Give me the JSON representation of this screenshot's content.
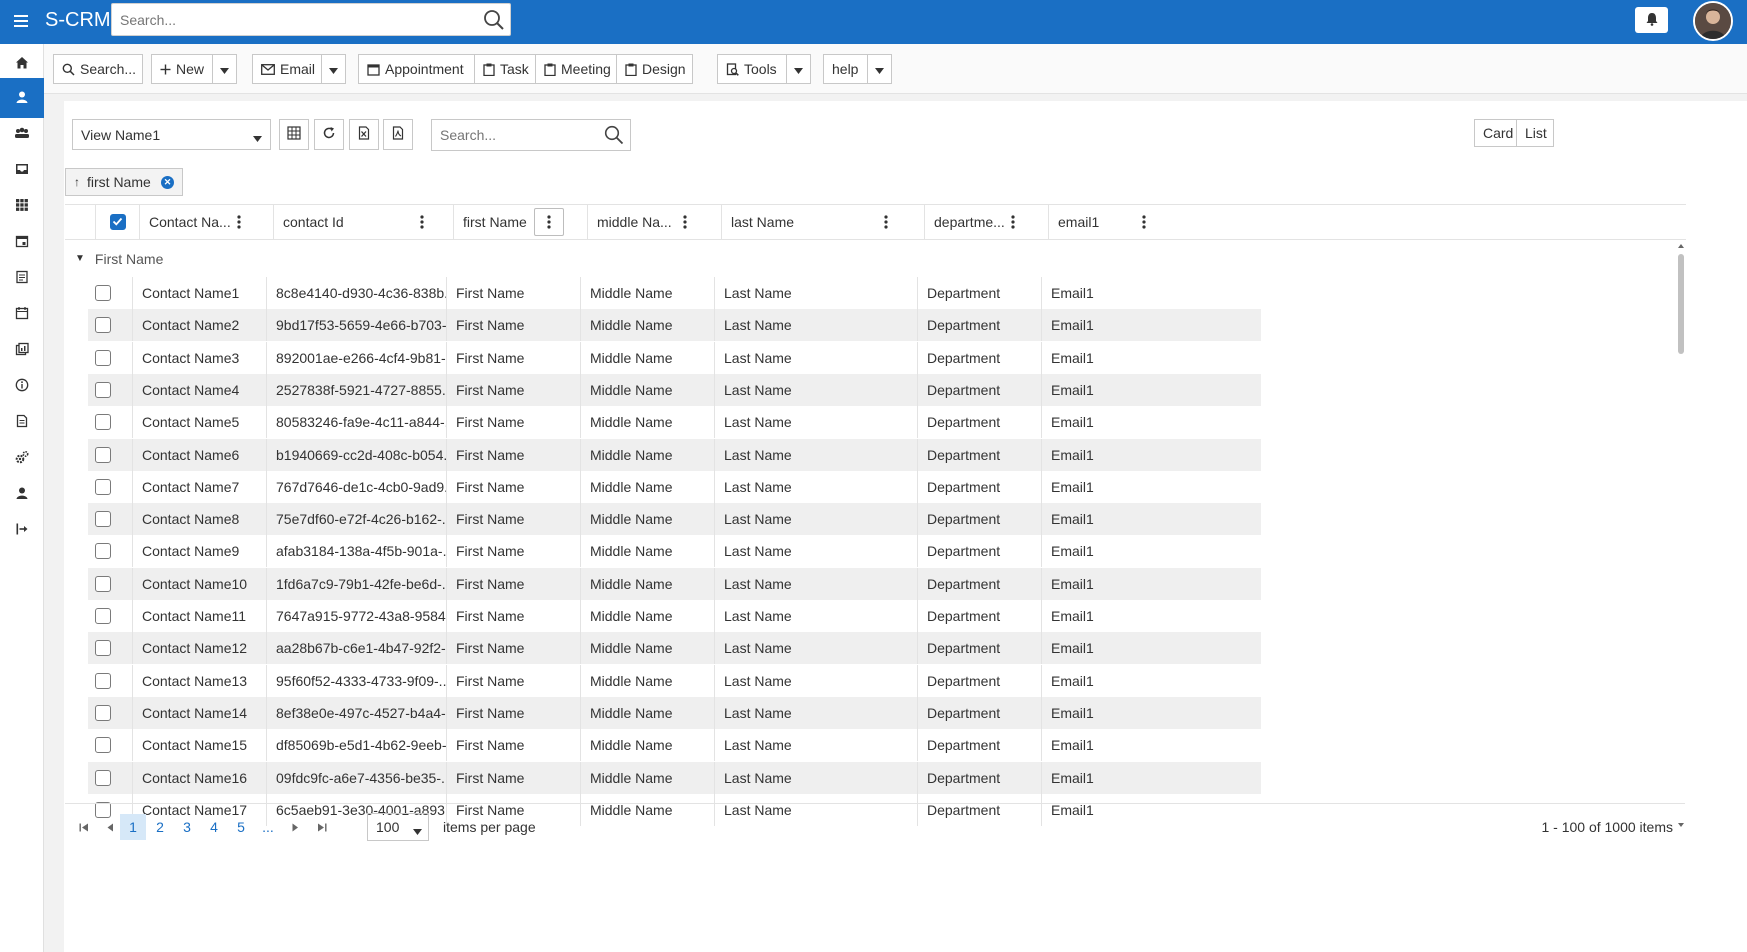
{
  "app": {
    "brand": "S-CRM",
    "search_placeholder": "Search..."
  },
  "toolbar": {
    "search_label": "Search...",
    "new_label": "New",
    "email_label": "Email",
    "appointment_label": "Appointment",
    "task_label": "Task",
    "meeting_label": "Meeting",
    "design_label": "Design",
    "tools_label": "Tools",
    "help_label": "help"
  },
  "grid_toolbar": {
    "view_name": "View Name1",
    "search_placeholder": "Search...",
    "card_label": "Card",
    "list_label": "List"
  },
  "grouping": {
    "chip_label": "first Name",
    "group_value": "First Name"
  },
  "columns": [
    "Contact Na...",
    "contact Id",
    "first Name",
    "middle Na...",
    "last Name",
    "departme...",
    "email1"
  ],
  "rows": [
    [
      "Contact Name1",
      "8c8e4140-d930-4c36-838b...",
      "First Name",
      "Middle Name",
      "Last Name",
      "Department",
      "Email1"
    ],
    [
      "Contact Name2",
      "9bd17f53-5659-4e66-b703-...",
      "First Name",
      "Middle Name",
      "Last Name",
      "Department",
      "Email1"
    ],
    [
      "Contact Name3",
      "892001ae-e266-4cf4-9b81-...",
      "First Name",
      "Middle Name",
      "Last Name",
      "Department",
      "Email1"
    ],
    [
      "Contact Name4",
      "2527838f-5921-4727-8855...",
      "First Name",
      "Middle Name",
      "Last Name",
      "Department",
      "Email1"
    ],
    [
      "Contact Name5",
      "80583246-fa9e-4c11-a844-...",
      "First Name",
      "Middle Name",
      "Last Name",
      "Department",
      "Email1"
    ],
    [
      "Contact Name6",
      "b1940669-cc2d-408c-b054...",
      "First Name",
      "Middle Name",
      "Last Name",
      "Department",
      "Email1"
    ],
    [
      "Contact Name7",
      "767d7646-de1c-4cb0-9ad9...",
      "First Name",
      "Middle Name",
      "Last Name",
      "Department",
      "Email1"
    ],
    [
      "Contact Name8",
      "75e7df60-e72f-4c26-b162-...",
      "First Name",
      "Middle Name",
      "Last Name",
      "Department",
      "Email1"
    ],
    [
      "Contact Name9",
      "afab3184-138a-4f5b-901a-...",
      "First Name",
      "Middle Name",
      "Last Name",
      "Department",
      "Email1"
    ],
    [
      "Contact Name10",
      "1fd6a7c9-79b1-42fe-be6d-...",
      "First Name",
      "Middle Name",
      "Last Name",
      "Department",
      "Email1"
    ],
    [
      "Contact Name11",
      "7647a915-9772-43a8-9584...",
      "First Name",
      "Middle Name",
      "Last Name",
      "Department",
      "Email1"
    ],
    [
      "Contact Name12",
      "aa28b67b-c6e1-4b47-92f2-...",
      "First Name",
      "Middle Name",
      "Last Name",
      "Department",
      "Email1"
    ],
    [
      "Contact Name13",
      "95f60f52-4333-4733-9f09-...",
      "First Name",
      "Middle Name",
      "Last Name",
      "Department",
      "Email1"
    ],
    [
      "Contact Name14",
      "8ef38e0e-497c-4527-b4a4-...",
      "First Name",
      "Middle Name",
      "Last Name",
      "Department",
      "Email1"
    ],
    [
      "Contact Name15",
      "df85069b-e5d1-4b62-9eeb-...",
      "First Name",
      "Middle Name",
      "Last Name",
      "Department",
      "Email1"
    ],
    [
      "Contact Name16",
      "09fdc9fc-a6e7-4356-be35-...",
      "First Name",
      "Middle Name",
      "Last Name",
      "Department",
      "Email1"
    ],
    [
      "Contact Name17",
      "6c5aeb91-3e30-4001-a893...",
      "First Name",
      "Middle Name",
      "Last Name",
      "Department",
      "Email1"
    ]
  ],
  "pager": {
    "pages": [
      "1",
      "2",
      "3",
      "4",
      "5",
      "..."
    ],
    "current_page": "1",
    "page_size": "100",
    "items_per_page_label": "items per page",
    "summary": "1 - 100 of 1000 items"
  },
  "sidebar_icons": [
    "home-icon",
    "contacts-icon",
    "accounts-icon",
    "inbox-icon",
    "apps-grid-icon",
    "calendar-icon",
    "notes-icon",
    "schedule-icon",
    "reports-icon",
    "info-icon",
    "documents-icon",
    "settings-icon",
    "user-icon",
    "logout-icon"
  ],
  "colors": {
    "primary": "#1a6fc4",
    "alt_row": "#efefef"
  }
}
